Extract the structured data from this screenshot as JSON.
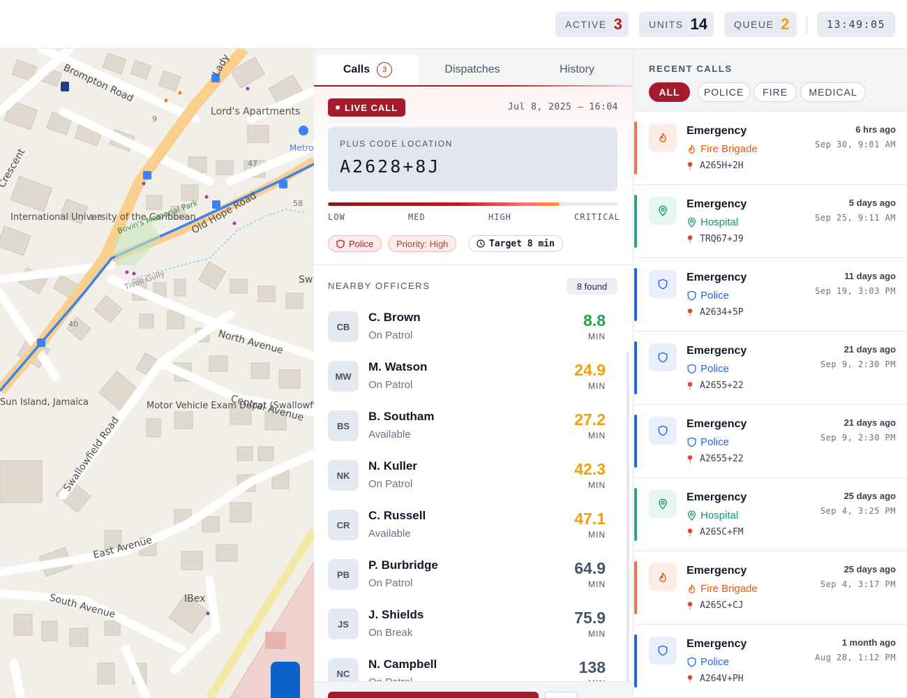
{
  "header": {
    "stats": [
      {
        "label": "ACTIVE",
        "value": "3",
        "color": "#b91c1c"
      },
      {
        "label": "UNITS",
        "value": "14",
        "color": "#111827"
      },
      {
        "label": "QUEUE",
        "value": "2",
        "color": "#f59e0b"
      }
    ],
    "clock": "13:49:05"
  },
  "map": {
    "labels": [
      "Brompton Road",
      "Lord's Apartments",
      "Lady",
      "Crescent",
      "International University of the Caribbean",
      "Bovin's Memorial Park",
      "Old Hope Road",
      "Tivoli Gully",
      "North Avenue",
      "Central Avenue",
      "Motor Vehicle Exam Depot (Swallowfield)",
      "Swallowfield Road",
      "Sun Island, Jamaica",
      "East Avenue",
      "South Avenue",
      "IBex",
      "Metro Car Re",
      "Sw",
      "9",
      "47",
      "58",
      "1-3",
      "40"
    ]
  },
  "tabs": [
    {
      "label": "Calls",
      "count": "3"
    },
    {
      "label": "Dispatches"
    },
    {
      "label": "History"
    }
  ],
  "call": {
    "live_label": "LIVE CALL",
    "time": "Jul 8, 2025 — 16:04",
    "plus_code_label": "PLUS CODE LOCATION",
    "plus_code": "A2628+8J",
    "severity": {
      "low": "LOW",
      "med": "MED",
      "high": "HIGH",
      "critical": "CRITICAL",
      "level": 0.8
    },
    "chips": {
      "service": "Police",
      "priority": "Priority: High",
      "target": "Target 8 min"
    }
  },
  "nearby": {
    "title": "NEARBY OFFICERS",
    "found": "8 found",
    "unit": "MIN",
    "officers": [
      {
        "initials": "CB",
        "name": "C. Brown",
        "status": "On Patrol",
        "eta": "8.8",
        "color": "#22a34a"
      },
      {
        "initials": "MW",
        "name": "M. Watson",
        "status": "On Patrol",
        "eta": "24.9",
        "color": "#f59e0b"
      },
      {
        "initials": "BS",
        "name": "B. Southam",
        "status": "Available",
        "eta": "27.2",
        "color": "#f59e0b"
      },
      {
        "initials": "NK",
        "name": "N. Kuller",
        "status": "On Patrol",
        "eta": "42.3",
        "color": "#f59e0b"
      },
      {
        "initials": "CR",
        "name": "C. Russell",
        "status": "Available",
        "eta": "47.1",
        "color": "#f59e0b"
      },
      {
        "initials": "PB",
        "name": "P. Burbridge",
        "status": "On Patrol",
        "eta": "64.9",
        "color": "#475569"
      },
      {
        "initials": "JS",
        "name": "J. Shields",
        "status": "On Break",
        "eta": "75.9",
        "color": "#475569"
      },
      {
        "initials": "NC",
        "name": "N. Campbell",
        "status": "On Patrol",
        "eta": "138",
        "color": "#475569"
      }
    ]
  },
  "recent": {
    "title": "RECENT CALLS",
    "filters": [
      "ALL",
      "POLICE",
      "FIRE",
      "MEDICAL"
    ],
    "calls": [
      {
        "title": "Emergency",
        "type": "Fire Brigade",
        "kind": "fire",
        "location": "A265H+2H",
        "ago": "6 hrs ago",
        "date": "Sep 30, 9:01 AM"
      },
      {
        "title": "Emergency",
        "type": "Hospital",
        "kind": "hospital",
        "location": "TRQ67+J9",
        "ago": "5 days ago",
        "date": "Sep 25, 9:11 AM"
      },
      {
        "title": "Emergency",
        "type": "Police",
        "kind": "police",
        "location": "A2634+5P",
        "ago": "11 days ago",
        "date": "Sep 19, 3:03 PM"
      },
      {
        "title": "Emergency",
        "type": "Police",
        "kind": "police",
        "location": "A2655+22",
        "ago": "21 days ago",
        "date": "Sep 9, 2:30 PM"
      },
      {
        "title": "Emergency",
        "type": "Police",
        "kind": "police",
        "location": "A2655+22",
        "ago": "21 days ago",
        "date": "Sep 9, 2:30 PM"
      },
      {
        "title": "Emergency",
        "type": "Hospital",
        "kind": "hospital",
        "location": "A265C+FM",
        "ago": "25 days ago",
        "date": "Sep 4, 3:25 PM"
      },
      {
        "title": "Emergency",
        "type": "Fire Brigade",
        "kind": "fire",
        "location": "A265C+CJ",
        "ago": "25 days ago",
        "date": "Sep 4, 3:17 PM"
      },
      {
        "title": "Emergency",
        "type": "Police",
        "kind": "police",
        "location": "A264V+PH",
        "ago": "1 month ago",
        "date": "Aug 28, 1:12 PM"
      }
    ],
    "kind_colors": {
      "fire": {
        "stripe": "#f0714a",
        "text": "#ea580c",
        "bg": "#fdece6"
      },
      "hospital": {
        "stripe": "#2aa58a",
        "text": "#169178",
        "bg": "#e6f6f1"
      },
      "police": {
        "stripe": "#2563eb",
        "text": "#2563eb",
        "bg": "#e8eefc"
      }
    }
  }
}
